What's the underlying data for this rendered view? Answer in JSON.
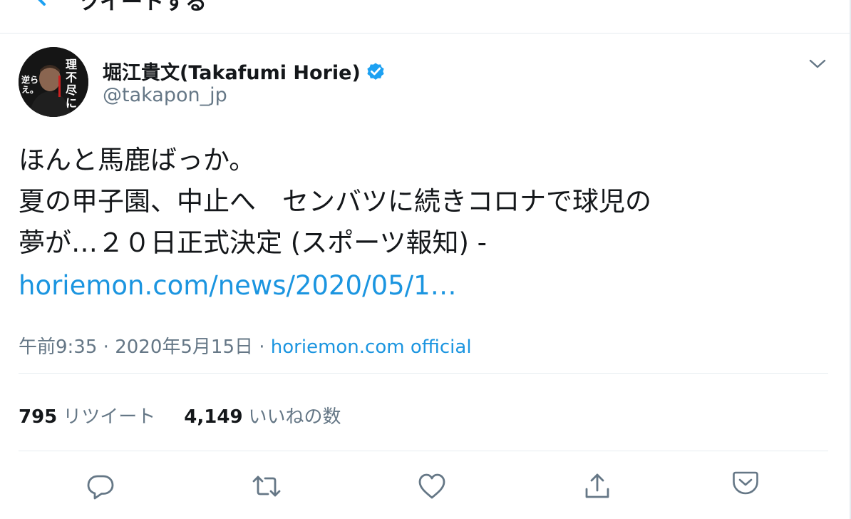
{
  "header": {
    "title": "ツイートする"
  },
  "user": {
    "display_name": "堀江貴文(Takafumi Horie)",
    "handle": "@takapon_jp",
    "verified": true,
    "avatar_text": "理不尽に逆らえ。"
  },
  "tweet": {
    "lines": [
      "ほんと馬鹿ばっか。",
      "夏の甲子園、中止へ　センバツに続きコロナで球児の",
      "夢が…２０日正式決定 (スポーツ報知) -"
    ],
    "link": "horiemon.com/news/2020/05/1…",
    "time": "午前9:35",
    "date": "2020年5月15日",
    "separator": "·",
    "source": "horiemon.com official"
  },
  "stats": {
    "retweets_count": "795",
    "retweets_label": "リツイート",
    "likes_count": "4,149",
    "likes_label": "いいねの数"
  },
  "actions": [
    "reply-icon",
    "retweet-icon",
    "like-icon",
    "share-icon",
    "bookmark-icon"
  ],
  "colors": {
    "link": "#1b95e0",
    "secondary_text": "#657786",
    "divider": "#e6ecf0",
    "verified": "#1da1f2"
  }
}
